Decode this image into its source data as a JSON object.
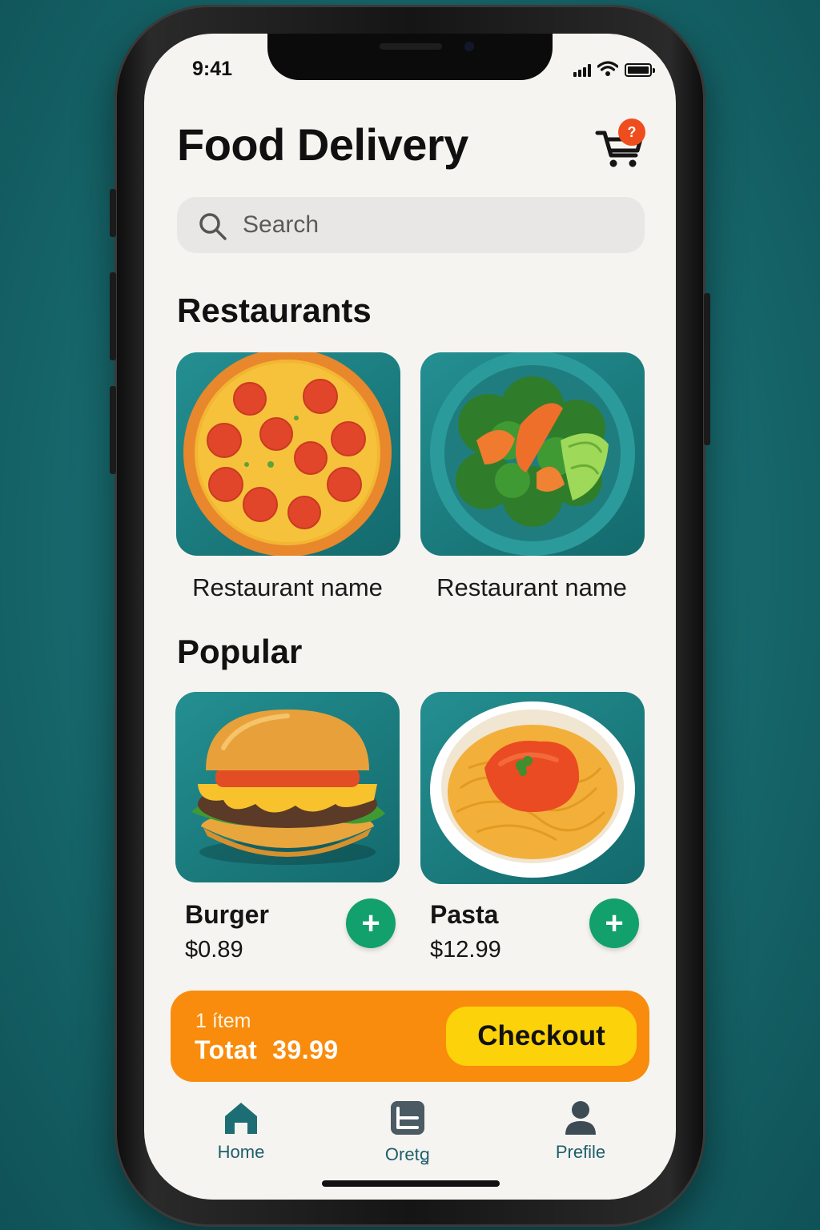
{
  "status_bar": {
    "time": "9:41"
  },
  "header": {
    "title": "Food Delivery",
    "cart_badge": "?"
  },
  "search": {
    "placeholder": "Search"
  },
  "restaurants": {
    "heading": "Restaurants",
    "items": [
      {
        "name": "Restaurant name",
        "image": "pizza"
      },
      {
        "name": "Restaurant name",
        "image": "salad-bowl"
      }
    ]
  },
  "popular": {
    "heading": "Popular",
    "items": [
      {
        "name": "Burger",
        "price": "$0.89",
        "image": "burger",
        "add_label": "+"
      },
      {
        "name": "Pasta",
        "price": "$12.99",
        "image": "pasta",
        "add_label": "+"
      }
    ]
  },
  "cart_bar": {
    "count": "1 ítem",
    "total": "Totat  39.99",
    "checkout_label": "Checkout"
  },
  "tabbar": {
    "items": [
      {
        "label": "Home",
        "icon": "home-icon",
        "active": true
      },
      {
        "label": "Oretꬶ",
        "icon": "orders-icon",
        "active": false
      },
      {
        "label": "Prefile",
        "icon": "profile-icon",
        "active": false
      }
    ]
  },
  "colors": {
    "background": "#17696d",
    "accent_green": "#12a06c",
    "cart_bar": "#f98c0d",
    "checkout": "#fcd20a",
    "badge": "#ef4d1e",
    "tab_text": "#1d5e6c"
  }
}
